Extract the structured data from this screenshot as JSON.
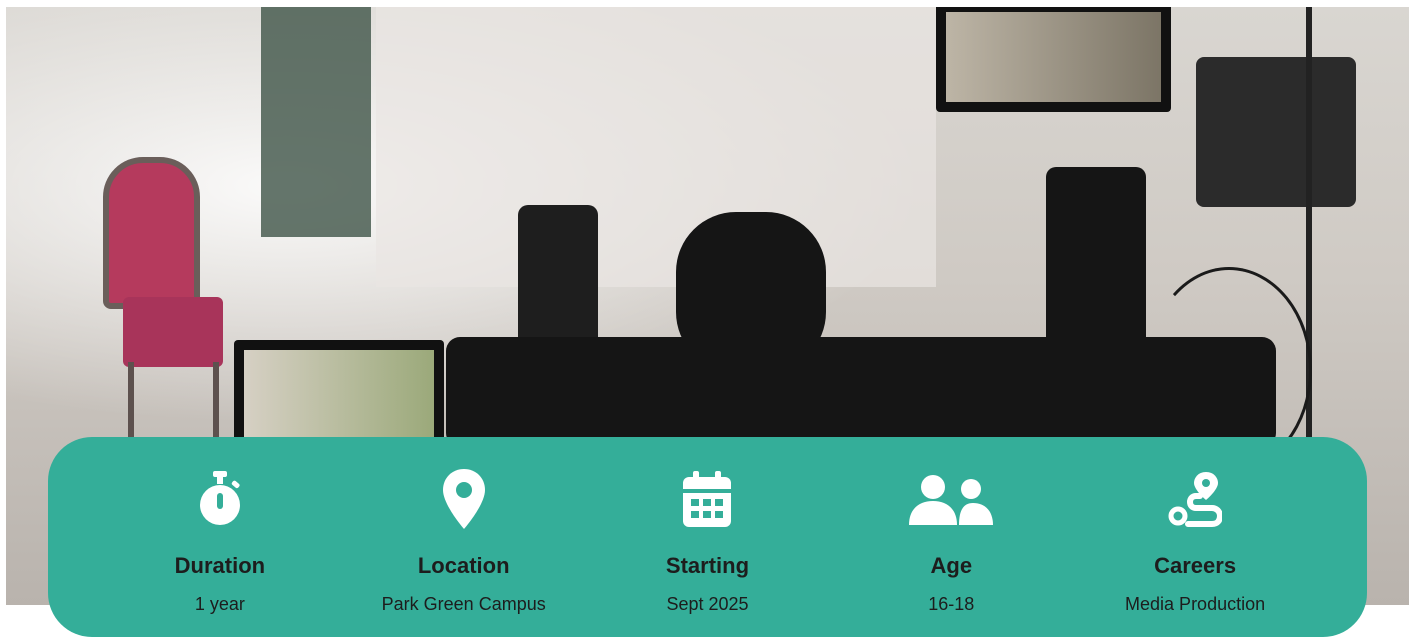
{
  "hero": {
    "image": "film-set-camera-rig"
  },
  "info": {
    "items": [
      {
        "icon": "stopwatch-icon",
        "title": "Duration",
        "value": "1 year"
      },
      {
        "icon": "map-pin-icon",
        "title": "Location",
        "value": "Park Green Campus"
      },
      {
        "icon": "calendar-icon",
        "title": "Starting",
        "value": "Sept 2025"
      },
      {
        "icon": "users-icon",
        "title": "Age",
        "value": "16-18"
      },
      {
        "icon": "route-icon",
        "title": "Careers",
        "value": "Media Production"
      }
    ]
  },
  "colors": {
    "panel": "#34ae99",
    "text": "#1d1d1d",
    "icon": "#ffffff"
  }
}
